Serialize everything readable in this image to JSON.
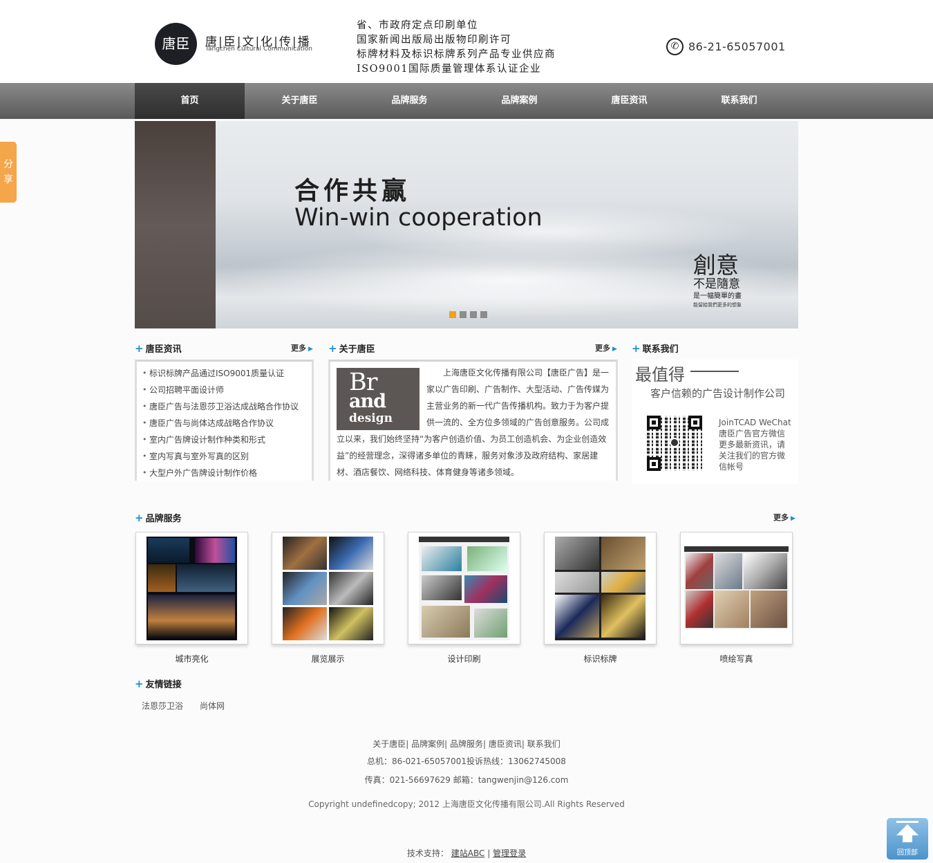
{
  "header": {
    "logo_mark": "唐臣",
    "logo_cn": "唐|臣|文|化|传|播",
    "logo_en": "Tangchen Cultural Communication",
    "slogan": [
      "省、市政府定点印刷单位",
      "国家新闻出版局出版物印刷许可",
      "标牌材料及标识标牌系列产品专业供应商",
      "ISO9001国际质量管理体系认证企业"
    ],
    "phone": "86-21-65057001"
  },
  "nav": {
    "items": [
      "首页",
      "关于唐臣",
      "品牌服务",
      "品牌案例",
      "唐臣资讯",
      "联系我们"
    ],
    "active": 0
  },
  "share": {
    "label": "分享"
  },
  "banner": {
    "title_cn": "合作共赢",
    "title_en": "Win-win cooperation",
    "side_big": "創意",
    "side_mid": "不是隨意",
    "side_small": "是一幅簡單的畫",
    "side_tiny": "能留給我們更多的想象",
    "slides": 4,
    "active_slide": 0
  },
  "news": {
    "title": "唐臣资讯",
    "more": "更多",
    "items": [
      "标识标牌产品通过ISO9001质量认证",
      "公司招聘平面设计师",
      "唐臣广告与法恩莎卫浴达成战略合作协议",
      "唐臣广告与尚体达成战略合作协议",
      "室内广告牌设计制作种类和形式",
      "室内写真与室外写真的区别",
      "大型户外广告牌设计制作价格"
    ]
  },
  "about": {
    "title": "关于唐臣",
    "more": "更多",
    "img_l1": "Br",
    "img_l2": "and",
    "img_l3": "design",
    "text": "上海唐臣文化传播有限公司【唐臣广告】是一家以广告印刷、广告制作、大型活动、广告传媒为主营业务的新一代广告传播机构。致力于为客户提供一流的、全方位多领域的广告创意服务。公司成立以来，我们始终坚持“为客户创造价值、为员工创造机会、为企业创造效益”的经营理念，深得诸多单位的青睐，服务对象涉及政府结构、家居建材、酒店餐饮、网络科技、体育健身等诸多领域。"
  },
  "contact": {
    "title": "联系我们",
    "big": "最值得",
    "sub": "客户信赖的广告设计制作公司",
    "wechat_lines": [
      "JoinTCAD WeChat",
      "唐臣广告官方微信",
      "更多最新资讯，请",
      "关注我们的官方微",
      "信帐号"
    ]
  },
  "services": {
    "title": "品牌服务",
    "more": "更多",
    "items": [
      "城市亮化",
      "展览展示",
      "设计印刷",
      "标识标牌",
      "喷绘写真"
    ]
  },
  "friends": {
    "title": "友情链接",
    "items": [
      "法恩莎卫浴",
      "尚体网"
    ]
  },
  "footer": {
    "links": "关于唐臣| 品牌案例| 品牌服务| 唐臣资讯| 联系我们",
    "tel": "总机：86-021-65057001投诉热线：13062745008",
    "fax": "传真：021-56697629 邮箱：tangwenjin@126.com",
    "copyright": "Copyright undefinedcopy; 2012 上海唐臣文化传播有限公司.All Rights Reserved",
    "tech_label": "技术支持：",
    "tech_link": "建站ABC",
    "separator": "|",
    "admin_link": "管理登录"
  },
  "back_top": {
    "label": "回顶部"
  },
  "colors": {
    "accent": "#1a8fd6",
    "nav_bg": "#6e6e6e",
    "nav_active": "#3a3a3a",
    "share": "#f5a54a",
    "slide_active": "#f0a01c"
  }
}
